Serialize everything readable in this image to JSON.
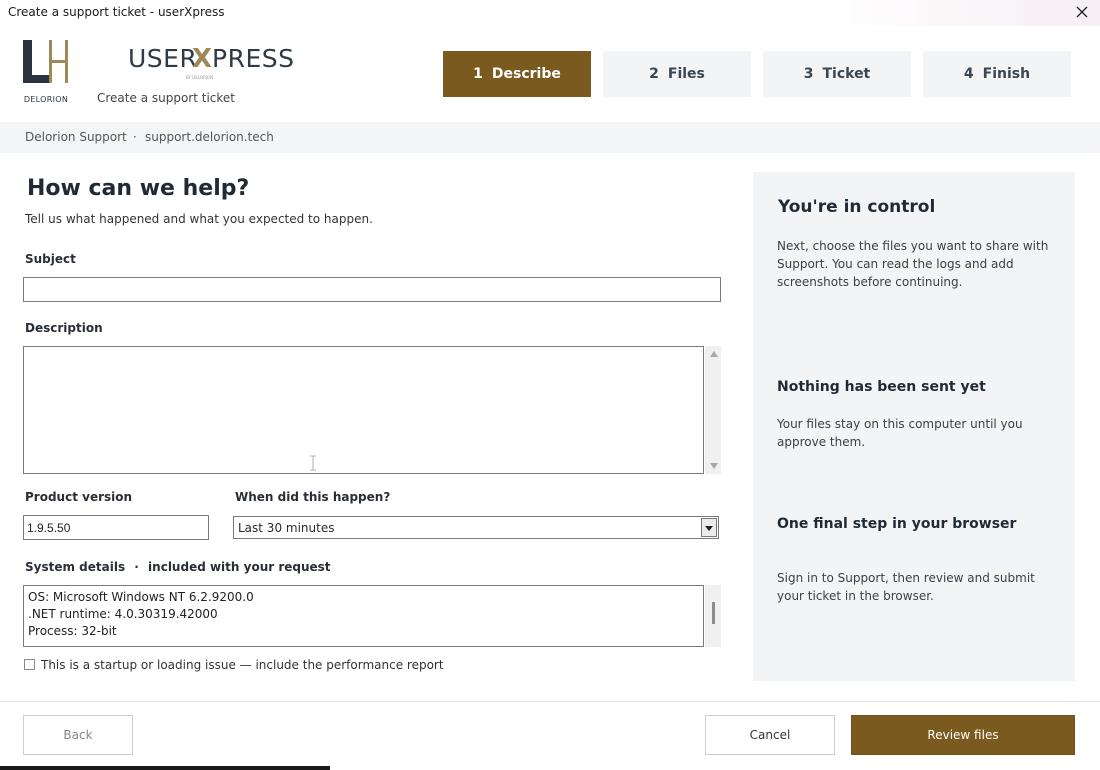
{
  "window": {
    "title": "Create a support ticket - userXpress"
  },
  "brand": {
    "logo_caption": "DELORION",
    "wordmark_left": "USER",
    "wordmark_x": "X",
    "wordmark_right": "PRESS",
    "wordmark_tagline": "BY DELORION",
    "subtitle": "Create a support ticket",
    "accent_color": "#7a5a1f",
    "dark_color": "#2a3440"
  },
  "steps": [
    {
      "num": "1",
      "label": "Describe",
      "active": true
    },
    {
      "num": "2",
      "label": "Files",
      "active": false
    },
    {
      "num": "3",
      "label": "Ticket",
      "active": false
    },
    {
      "num": "4",
      "label": "Finish",
      "active": false
    }
  ],
  "breadcrumb": {
    "site": "Delorion Support",
    "separator": "·",
    "url": "support.delorion.tech"
  },
  "form": {
    "title": "How can we help?",
    "subtitle": "Tell us what happened and what you expected to happen.",
    "subject_label": "Subject",
    "subject_value": "",
    "description_label": "Description",
    "description_value": "",
    "version_label": "Product version",
    "version_value": "1.9.5.50",
    "when_label": "When did this happen?",
    "when_value": "Last 30 minutes",
    "system_label": "System details",
    "system_separator": "·",
    "system_note": "included with your request",
    "system_lines": [
      "OS: Microsoft Windows NT 6.2.9200.0",
      ".NET runtime: 4.0.30319.42000",
      "Process: 32-bit"
    ],
    "startup_checkbox_label": "This is a startup or loading issue — include the performance report",
    "startup_checked": false
  },
  "sidebar": {
    "heading": "You're in control",
    "intro": "Next, choose the files you want to share with Support. You can read the logs and add screenshots before continuing.",
    "sections": [
      {
        "title": "Nothing has been sent yet",
        "body": "Your files stay on this computer until you approve them."
      },
      {
        "title": "One final step in your browser",
        "body": "Sign in to Support, then review and submit your ticket in the browser."
      }
    ]
  },
  "footer": {
    "back_label": "Back",
    "cancel_label": "Cancel",
    "next_label": "Review files"
  }
}
